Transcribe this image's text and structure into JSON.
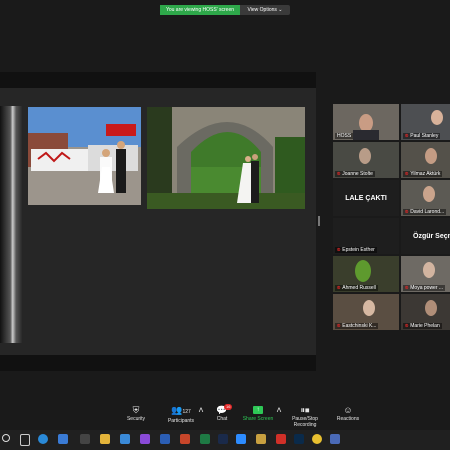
{
  "banner": {
    "viewing_text": "You are viewing HOSS' screen",
    "view_options": "View Options ⌄"
  },
  "gallery": {
    "participants": [
      {
        "name": "HOSS",
        "active": true,
        "muted": false,
        "type": "video"
      },
      {
        "name": "Paul Stanley",
        "active": false,
        "muted": true,
        "type": "video"
      },
      {
        "name": "Joanne Stolte",
        "active": false,
        "muted": true,
        "type": "video"
      },
      {
        "name": "Yilmaz Aktürk",
        "active": false,
        "muted": true,
        "type": "video"
      },
      {
        "name": "LALE ÇAKTI",
        "active": false,
        "muted": false,
        "type": "name"
      },
      {
        "name": "David Larond...",
        "active": false,
        "muted": true,
        "type": "video"
      },
      {
        "name": "Epstein Esther",
        "active": false,
        "muted": true,
        "type": "dark"
      },
      {
        "name": "Özgür Seçme",
        "active": false,
        "muted": false,
        "type": "name"
      },
      {
        "name": "Ahmed Russell",
        "active": false,
        "muted": true,
        "type": "video"
      },
      {
        "name": "Moya power ...",
        "active": false,
        "muted": true,
        "type": "video"
      },
      {
        "name": "Eastchinski K...",
        "active": false,
        "muted": true,
        "type": "video"
      },
      {
        "name": "Marie Phelan",
        "active": false,
        "muted": true,
        "type": "video"
      }
    ]
  },
  "toolbar": {
    "security": "Security",
    "participants": "Participants",
    "participants_count": "127",
    "chat": "Chat",
    "chat_badge": "16",
    "share_screen": "Share Screen",
    "recording": "Pause/Stop Recording",
    "reactions": "Reactions"
  },
  "colors": {
    "accent_green": "#2ea84a",
    "share_green": "#2ec856",
    "active_border": "#d8d100",
    "mute_red": "#e02828"
  }
}
